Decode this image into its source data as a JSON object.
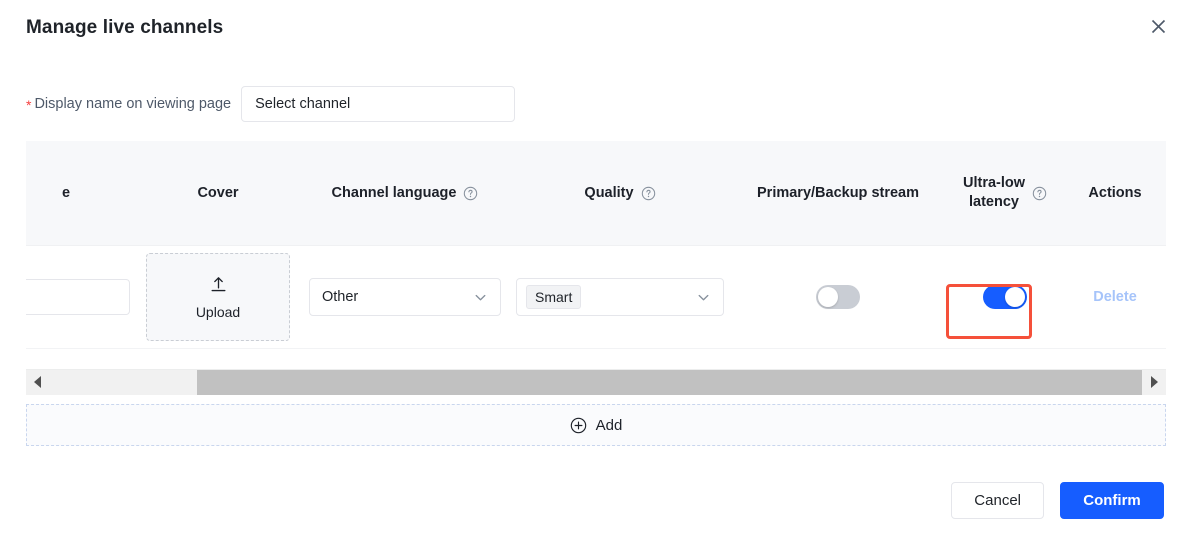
{
  "dialog": {
    "title": "Manage live channels",
    "close_icon": "close-icon"
  },
  "form": {
    "required_marker": "*",
    "label": "Display name on viewing page",
    "channel_select": {
      "value": "Select channel",
      "placeholder": "Select channel"
    }
  },
  "table": {
    "columns": [
      {
        "key": "name",
        "label": "e",
        "has_help": false
      },
      {
        "key": "cover",
        "label": "Cover",
        "has_help": false
      },
      {
        "key": "language",
        "label": "Channel language",
        "has_help": true
      },
      {
        "key": "quality",
        "label": "Quality",
        "has_help": true
      },
      {
        "key": "stream",
        "label": "Primary/Backup stream",
        "has_help": false
      },
      {
        "key": "ultra_low_latency",
        "label_line1": "Ultra-low",
        "label_line2": "latency",
        "has_help": true
      },
      {
        "key": "actions",
        "label": "Actions",
        "has_help": false
      }
    ],
    "rows": [
      {
        "cover": {
          "icon": "upload-icon",
          "label": "Upload"
        },
        "language": {
          "value": "Other"
        },
        "quality": {
          "tag": "Smart"
        },
        "stream": {
          "toggle_on": false
        },
        "ultra_low_latency": {
          "toggle_on": true,
          "highlighted": true
        },
        "actions": {
          "delete_label": "Delete"
        }
      }
    ]
  },
  "scrollbar": {
    "left_arrow": "caret-left-icon",
    "right_arrow": "caret-right-icon"
  },
  "add_row": {
    "icon": "plus-circle-icon",
    "label": "Add"
  },
  "footer": {
    "cancel_label": "Cancel",
    "confirm_label": "Confirm"
  },
  "colors": {
    "accent": "#165dff",
    "required": "#f53f3f",
    "highlight": "#f5503a",
    "header_bg": "#f7f8fa",
    "toggle_off": "#c9cdd4",
    "delete_disabled": "#a6c4fa"
  }
}
